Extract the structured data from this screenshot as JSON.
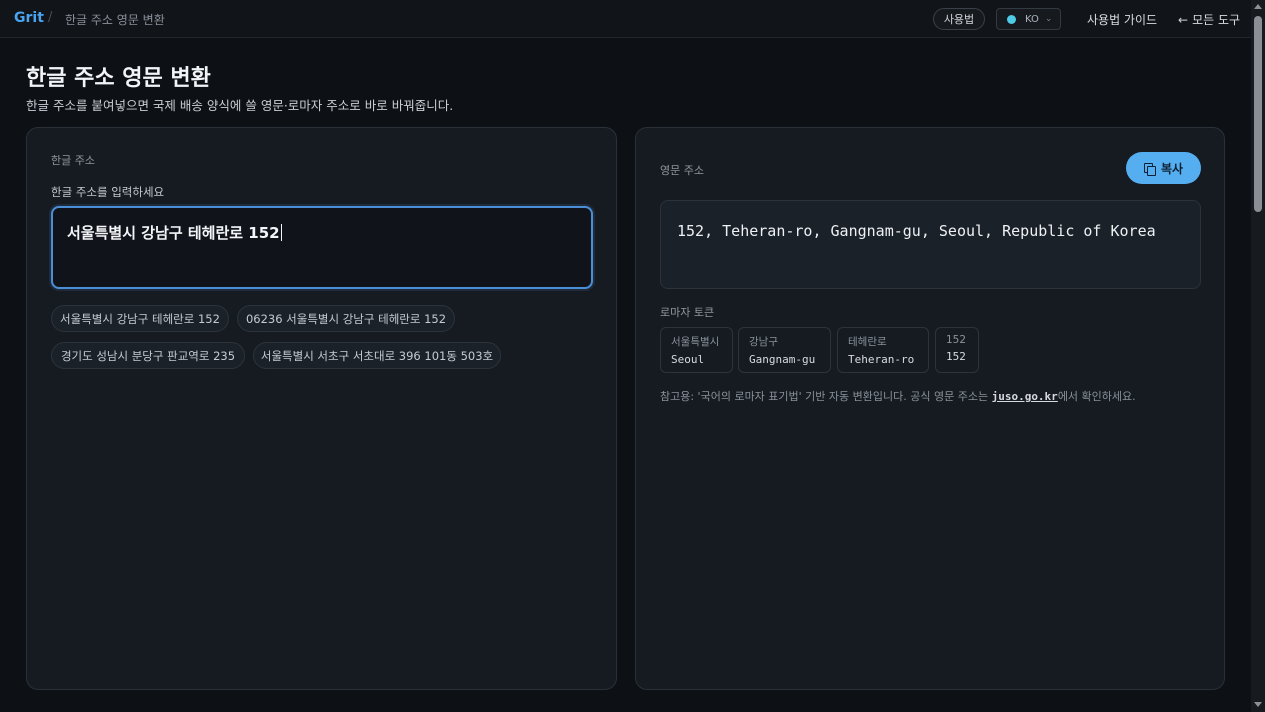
{
  "header": {
    "brand": "Grit",
    "separator": "/",
    "breadcrumb": "한글 주소 영문 변환",
    "usage_label": "사용법",
    "lang_label": "KO",
    "lang_chevron": "⌄",
    "guide_label": "사용법 가이드",
    "all_tools_arrow": "←",
    "all_tools_label": "모든 도구"
  },
  "page": {
    "title": "한글 주소 영문 변환",
    "subtitle": "한글 주소를 붙여넣으면 국제 배송 양식에 쓸 영문·로마자 주소로 바로 바꿔줍니다."
  },
  "input_panel": {
    "section_label": "한글 주소",
    "field_label": "한글 주소를 입력하세요",
    "value": "서울특별시 강남구 테헤란로 152",
    "examples": [
      "서울특별시 강남구 테헤란로 152",
      "06236 서울특별시 강남구 테헤란로 152",
      "경기도 성남시 분당구 판교역로 235",
      "서울특별시 서초구 서초대로 396 101동 503호"
    ]
  },
  "output_panel": {
    "section_label": "영문 주소",
    "copy_label": "복사",
    "copy_icon": "copy-icon",
    "result": "152, Teheran-ro, Gangnam-gu, Seoul, Republic of Korea",
    "tokens_label": "로마자 토큰",
    "tokens": [
      {
        "ko": "서울특별시",
        "en": "Seoul"
      },
      {
        "ko": "강남구",
        "en": "Gangnam-gu"
      },
      {
        "ko": "테헤란로",
        "en": "Teheran-ro"
      },
      {
        "ko": "152",
        "en": "152"
      }
    ],
    "note_before": "참고용: '국어의 로마자 표기법' 기반 자동 변환입니다. 공식 영문 주소는 ",
    "note_link": "juso.go.kr",
    "note_after": "에서 확인하세요."
  },
  "colors": {
    "accent": "#55aef0",
    "brand": "#4aa3f0",
    "background": "#0d1014",
    "panel": "#161b22"
  }
}
